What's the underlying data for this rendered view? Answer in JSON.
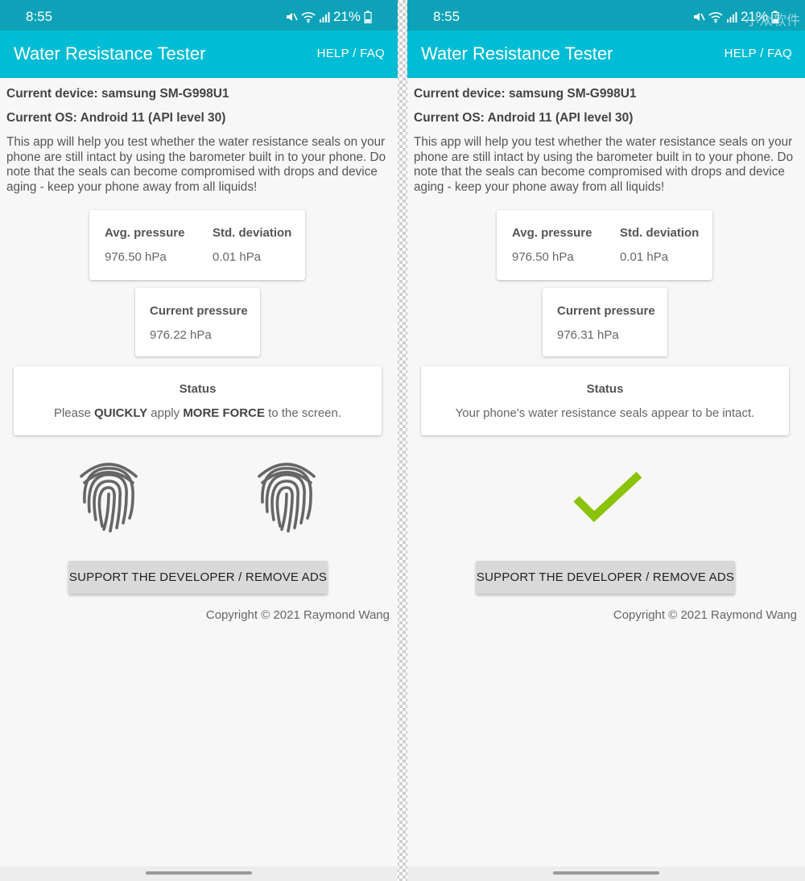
{
  "screens": [
    {
      "status_bar": {
        "time": "8:55",
        "battery": "21%",
        "icons": [
          "mute-icon",
          "wifi-icon",
          "signal-icon",
          "battery-icon"
        ]
      },
      "app_bar": {
        "title": "Water Resistance Tester",
        "help": "HELP / FAQ"
      },
      "info": {
        "device": "Current device: samsung SM-G998U1",
        "os": "Current OS: Android 11 (API level 30)",
        "description": "This app will help you test whether the water resistance seals on your phone are still intact by using the barometer built in to your phone. Do note that the seals can become compromised with drops and device aging - keep your phone away from all liquids!"
      },
      "avg": {
        "label": "Avg. pressure",
        "value": "976.50 hPa"
      },
      "std": {
        "label": "Std. deviation",
        "value": "0.01 hPa"
      },
      "current": {
        "label": "Current pressure",
        "value": "976.22 hPa"
      },
      "status": {
        "title": "Status",
        "msg_1": "Please ",
        "msg_2": "QUICKLY",
        "msg_3": " apply ",
        "msg_4": "MORE FORCE",
        "msg_5": " to the screen."
      },
      "indicator": "fingerprint-icon",
      "support_button": "SUPPORT THE DEVELOPER / REMOVE ADS",
      "copyright": "Copyright © 2021 Raymond Wang"
    },
    {
      "status_bar": {
        "time": "8:55",
        "battery": "21%",
        "watermark": "小众软件",
        "icons": [
          "mute-icon",
          "wifi-icon",
          "signal-icon",
          "battery-icon"
        ]
      },
      "app_bar": {
        "title": "Water Resistance Tester",
        "help": "HELP / FAQ"
      },
      "info": {
        "device": "Current device: samsung SM-G998U1",
        "os": "Current OS: Android 11 (API level 30)",
        "description": "This app will help you test whether the water resistance seals on your phone are still intact by using the barometer built in to your phone. Do note that the seals can become compromised with drops and device aging - keep your phone away from all liquids!"
      },
      "avg": {
        "label": "Avg. pressure",
        "value": "976.50 hPa"
      },
      "std": {
        "label": "Std. deviation",
        "value": "0.01 hPa"
      },
      "current": {
        "label": "Current pressure",
        "value": "976.31 hPa"
      },
      "status": {
        "title": "Status",
        "msg": "Your phone's water resistance seals appear to be intact."
      },
      "indicator": "checkmark-icon",
      "support_button": "SUPPORT THE DEVELOPER / REMOVE ADS",
      "copyright": "Copyright © 2021 Raymond Wang"
    }
  ],
  "colors": {
    "status_bar": "#0da2b8",
    "app_bar": "#00bcd4",
    "screen_background": "#f7f7f7",
    "check_green": "#8bc20a",
    "fingerprint": "#666666"
  }
}
